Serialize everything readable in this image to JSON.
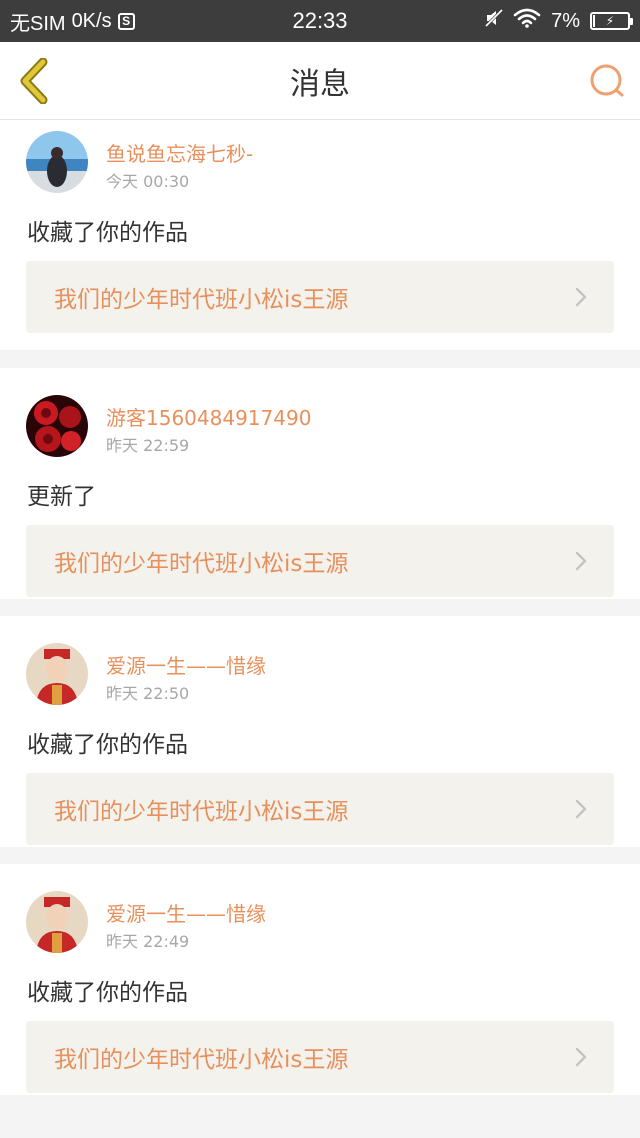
{
  "status_bar": {
    "carrier": "无SIM",
    "speed": "0K/s",
    "s_badge": "S",
    "time": "22:33",
    "battery": "7%",
    "battery_level": 0.07,
    "icons": [
      "mute-icon",
      "wifi-icon",
      "battery-icon"
    ]
  },
  "nav": {
    "title": "消息",
    "back_icon": "chevron-left-icon",
    "search_icon": "search-icon",
    "accent_back": "#d9c235",
    "accent_search": "#f0a070"
  },
  "colors": {
    "username": "#e8905c",
    "work_title": "#e8905c",
    "timestamp": "#a7a7a7",
    "link_bg": "#f3f2ec"
  },
  "messages": [
    {
      "username": "鱼说鱼忘海七秒-",
      "time": "今天 00:30",
      "action": "收藏了你的作品",
      "work_title": "我们的少年时代班小松is王源"
    },
    {
      "username": "游客1560484917490",
      "time": "昨天 22:59",
      "action": "更新了",
      "work_title": "我们的少年时代班小松is王源"
    },
    {
      "username": "爱源一生——惜缘",
      "time": "昨天 22:50",
      "action": "收藏了你的作品",
      "work_title": "我们的少年时代班小松is王源"
    },
    {
      "username": "爱源一生——惜缘",
      "time": "昨天 22:49",
      "action": "收藏了你的作品",
      "work_title": "我们的少年时代班小松is王源"
    }
  ]
}
